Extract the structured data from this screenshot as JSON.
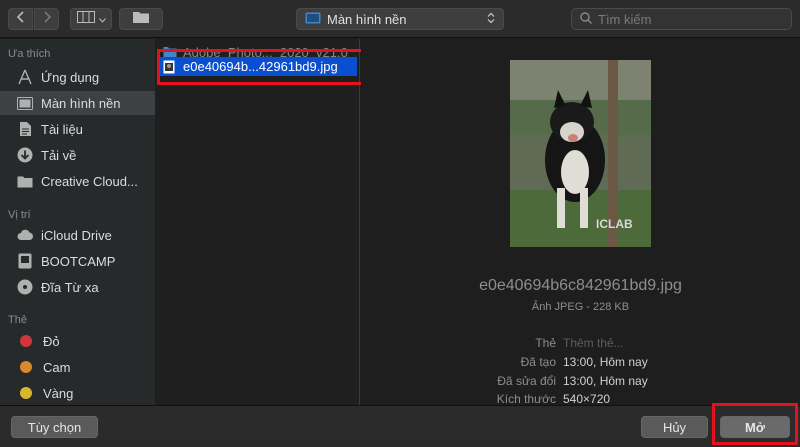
{
  "toolbar": {
    "back_icon": "chevron-left-icon",
    "forward_icon": "chevron-right-icon",
    "view_icon": "column-view-icon",
    "new_folder_icon": "folder-icon",
    "location": "Màn hình nền",
    "search_placeholder": "Tìm kiếm"
  },
  "sidebar": {
    "sections": {
      "favorites": "Ưa thích",
      "locations": "Vị trí",
      "tags": "Thẻ"
    },
    "favorites": [
      {
        "label": "Ứng dụng",
        "icon": "applications-icon"
      },
      {
        "label": "Màn hình nền",
        "icon": "desktop-icon",
        "selected": true
      },
      {
        "label": "Tài liệu",
        "icon": "document-icon"
      },
      {
        "label": "Tải về",
        "icon": "download-icon"
      },
      {
        "label": "Creative Cloud...",
        "icon": "folder-icon"
      }
    ],
    "locations": [
      {
        "label": "iCloud Drive",
        "icon": "cloud-icon"
      },
      {
        "label": "BOOTCAMP",
        "icon": "drive-icon"
      },
      {
        "label": "Đĩa Từ xa",
        "icon": "disc-icon"
      }
    ],
    "tags": [
      {
        "label": "Đỏ",
        "color": "#d0373d"
      },
      {
        "label": "Cam",
        "color": "#d9882b"
      },
      {
        "label": "Vàng",
        "color": "#d9b62c"
      }
    ]
  },
  "files": {
    "dimmed": "Adobe_Photo..._2020_v21.0",
    "selected": "e0e40694b...42961bd9.jpg"
  },
  "preview": {
    "filename": "e0e40694b6c842961bd9.jpg",
    "kind": "Ảnh JPEG - 228 KB",
    "watermark": "ICLAB",
    "meta": [
      {
        "key": "Thẻ",
        "value": "Thêm thẻ...",
        "muted": true
      },
      {
        "key": "Đã tạo",
        "value": "13:00, Hôm nay"
      },
      {
        "key": "Đã sửa đổi",
        "value": "13:00, Hôm nay"
      },
      {
        "key": "Kích thước",
        "value": "540×720"
      }
    ]
  },
  "buttons": {
    "options": "Tùy chọn",
    "cancel": "Hủy",
    "open": "Mở"
  }
}
